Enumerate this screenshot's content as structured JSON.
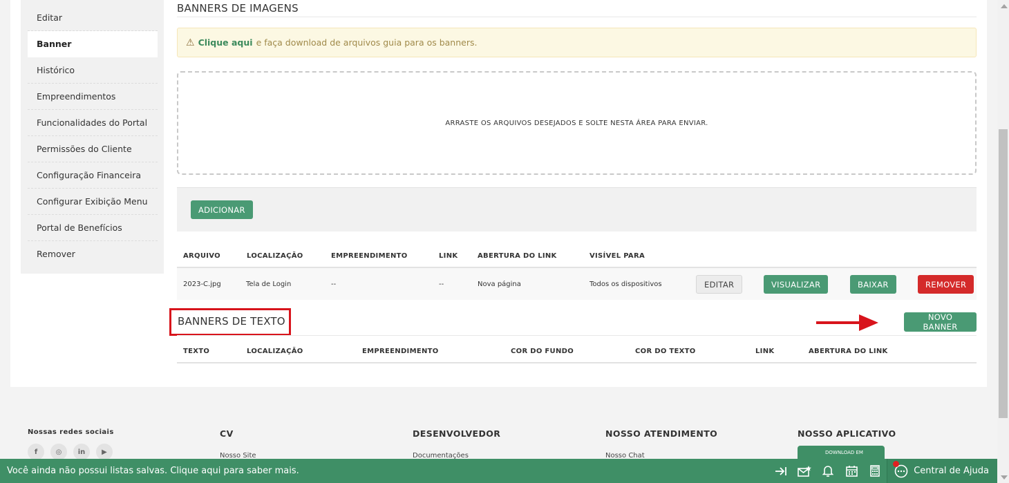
{
  "sidebar": {
    "items": [
      {
        "label": "Editar"
      },
      {
        "label": "Banner"
      },
      {
        "label": "Histórico"
      },
      {
        "label": "Empreendimentos"
      },
      {
        "label": "Funcionalidades do Portal"
      },
      {
        "label": "Permissões do Cliente"
      },
      {
        "label": "Configuração Financeira"
      },
      {
        "label": "Configurar Exibição Menu"
      },
      {
        "label": "Portal de Benefícios"
      },
      {
        "label": "Remover"
      }
    ]
  },
  "banners_imagens": {
    "title": "BANNERS DE IMAGENS",
    "alert_link": "Clique aqui",
    "alert_text": "e faça download de arquivos guia para os banners.",
    "dropzone_text": "ARRASTE OS ARQUIVOS DESEJADOS E SOLTE NESTA ÁREA PARA ENVIAR.",
    "add_button": "ADICIONAR",
    "columns": [
      "ARQUIVO",
      "LOCALIZAÇÃO",
      "EMPREENDIMENTO",
      "LINK",
      "ABERTURA DO LINK",
      "VISÍVEL PARA"
    ],
    "rows": [
      {
        "arquivo": "2023-C.jpg",
        "localizacao": "Tela de Login",
        "empreendimento": "--",
        "link": "--",
        "abertura": "Nova página",
        "visivel": "Todos os dispositivos",
        "actions": {
          "editar": "EDITAR",
          "visualizar": "VISUALIZAR",
          "baixar": "BAIXAR",
          "remover": "REMOVER"
        }
      }
    ]
  },
  "banners_texto": {
    "title": "BANNERS DE TEXTO",
    "new_button": "NOVO BANNER",
    "columns": [
      "TEXTO",
      "LOCALIZAÇÃO",
      "EMPREENDIMENTO",
      "COR DO FUNDO",
      "COR DO TEXTO",
      "LINK",
      "ABERTURA DO LINK"
    ]
  },
  "footer": {
    "social_title": "Nossas redes sociais",
    "social_icons": [
      "f",
      "◎",
      "in",
      "▶"
    ],
    "cols": [
      {
        "title": "CV",
        "link": "Nosso Site"
      },
      {
        "title": "DESENVOLVEDOR",
        "link": "Documentações"
      },
      {
        "title": "NOSSO ATENDIMENTO",
        "link": "Nosso Chat"
      },
      {
        "title": "NOSSO APLICATIVO",
        "link": ""
      }
    ],
    "store_text": "DOWNLOAD EM"
  },
  "bottombar": {
    "message": "Você ainda não possui listas salvas. Clique aqui para saber mais.",
    "help_label": "Central de Ajuda"
  },
  "colors": {
    "primary_green": "#4a9a74",
    "danger_red": "#d42a2a",
    "highlight_red": "#d8141c"
  }
}
